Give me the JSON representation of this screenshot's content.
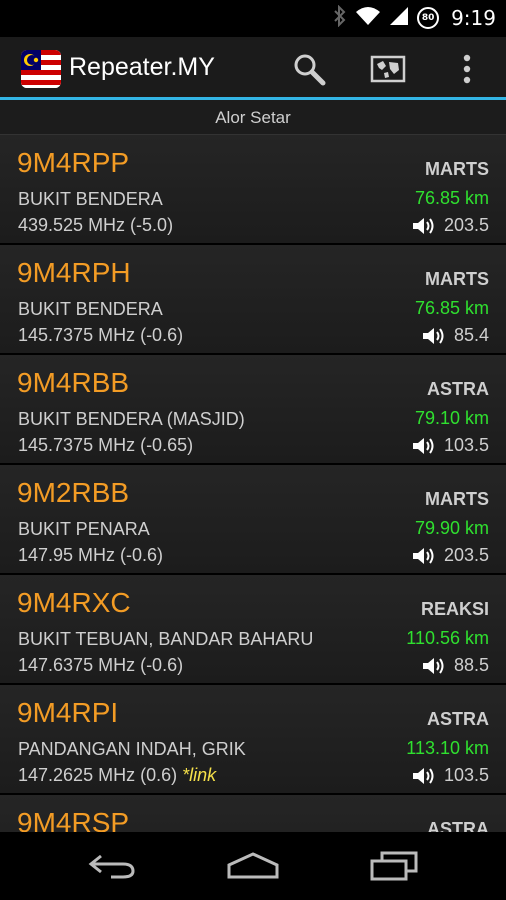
{
  "status": {
    "time": "9:19",
    "battery": "80"
  },
  "app": {
    "title": "Repeater.MY"
  },
  "actions": [
    "search-icon",
    "map-icon",
    "overflow-menu-icon"
  ],
  "location_header": "Alor Setar",
  "repeaters": [
    {
      "callsign": "9M4RPP",
      "location": "BUKIT BENDERA",
      "freq": "439.525 MHz (-5.0)",
      "link": "",
      "org": "MARTS",
      "distance": "76.85 km",
      "tone": "203.5"
    },
    {
      "callsign": "9M4RPH",
      "location": "BUKIT BENDERA",
      "freq": "145.7375 MHz (-0.6)",
      "link": "",
      "org": "MARTS",
      "distance": "76.85 km",
      "tone": "85.4"
    },
    {
      "callsign": "9M4RBB",
      "location": "BUKIT BENDERA (MASJID)",
      "freq": "145.7375 MHz (-0.65)",
      "link": "",
      "org": "ASTRA",
      "distance": "79.10 km",
      "tone": "103.5"
    },
    {
      "callsign": "9M2RBB",
      "location": "BUKIT PENARA",
      "freq": "147.95 MHz (-0.6)",
      "link": "",
      "org": "MARTS",
      "distance": "79.90 km",
      "tone": "203.5"
    },
    {
      "callsign": "9M4RXC",
      "location": "BUKIT TEBUAN, BANDAR BAHARU",
      "freq": "147.6375 MHz (-0.6)",
      "link": "",
      "org": "REAKSI",
      "distance": "110.56 km",
      "tone": "88.5"
    },
    {
      "callsign": "9M4RPI",
      "location": "PANDANGAN INDAH, GRIK",
      "freq": "147.2625 MHz (0.6)",
      "link": "*link",
      "org": "ASTRA",
      "distance": "113.10 km",
      "tone": "103.5"
    },
    {
      "callsign": "9M4RSP",
      "location": "",
      "freq": "",
      "link": "",
      "org": "ASTRA",
      "distance": "",
      "tone": ""
    }
  ],
  "colors": {
    "accent": "#33b5e5",
    "callsign": "#f39c25",
    "distance": "#2fe02f",
    "link": "#f5e04a"
  }
}
